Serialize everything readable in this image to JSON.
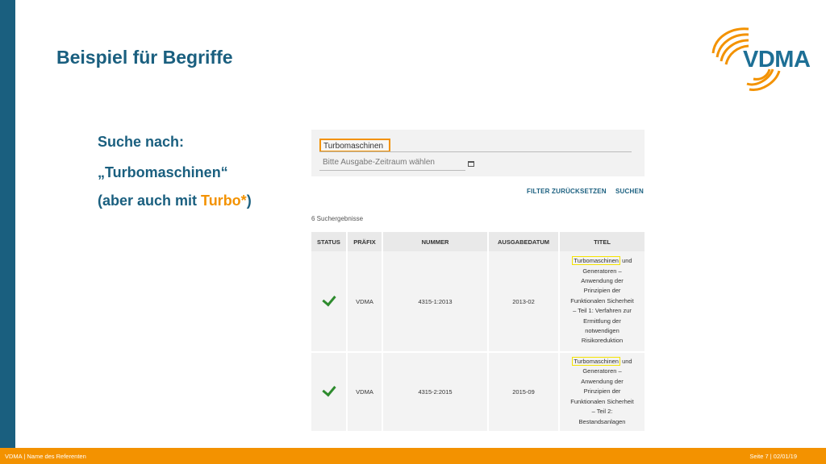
{
  "slide": {
    "title": "Beispiel für Begriffe",
    "lines": {
      "l1": "Suche nach:",
      "l2": "„Turbomaschinen“",
      "l3_prefix": "(aber auch mit ",
      "l3_accent": "Turbo*",
      "l3_suffix": ")"
    }
  },
  "logo": {
    "text": "VDMA"
  },
  "footer": {
    "left": "VDMA | Name des Referenten",
    "right": "Seite 7 | 02/01/19"
  },
  "colors": {
    "brand_blue": "#1a5f7f",
    "accent_orange": "#f39200",
    "highlight_yellow": "#f4e300",
    "check_green": "#2e8b2e"
  },
  "screenshot": {
    "search_value": "Turbomaschinen",
    "date_placeholder": "Bitte Ausgabe-Zeitraum wählen",
    "date_icon": "calendar-icon",
    "buttons": {
      "reset": "FILTER ZURÜCKSETZEN",
      "search": "SUCHEN"
    },
    "result_count": "6 Suchergebnisse",
    "columns": {
      "status": "STATUS",
      "prefix": "PRÄFIX",
      "number": "NUMMER",
      "date": "AUSGABEDATUM",
      "title": "TITEL"
    },
    "rows": [
      {
        "status_icon": "check-icon",
        "prefix": "VDMA",
        "number": "4315-1:2013",
        "date": "2013-02",
        "title_highlight": "Turbomaschinen",
        "title_lines": [
          " und",
          "Generatoren –",
          "Anwendung der",
          "Prinzipien der",
          "Funktionalen Sicherheit",
          "– Teil 1: Verfahren zur",
          "Ermittlung der",
          "notwendigen",
          "Risikoreduktion"
        ]
      },
      {
        "status_icon": "check-icon",
        "prefix": "VDMA",
        "number": "4315-2:2015",
        "date": "2015-09",
        "title_highlight": "Turbomaschinen",
        "title_lines": [
          " und",
          "Generatoren –",
          "Anwendung der",
          "Prinzipien der",
          "Funktionalen Sicherheit",
          "– Teil 2:",
          "Bestandsanlagen"
        ]
      }
    ]
  }
}
